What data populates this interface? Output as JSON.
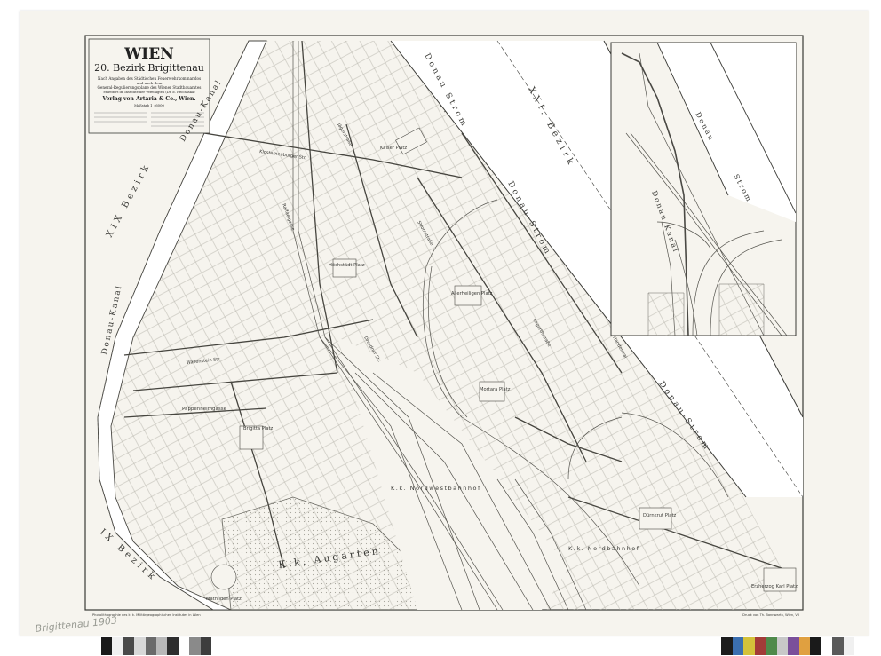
{
  "title_block": {
    "city": "WIEN",
    "district": "20. Bezirk Brigittenau",
    "subtitle_1": "Nach Angaben des Städtischen Feuerwehrkommandos",
    "subtitle_2": "und nach dem",
    "subtitle_3": "General-Regulierungsplane des Wiener Stadtbauamtes",
    "subtitle_4": "erweitert im Institute der Vereinigten (Dr. E. Prochaska)",
    "publisher": "Verlag von Artaria & Co., Wien.",
    "scale": "Maßstab 1 : 6000"
  },
  "regions": {
    "bezirk_xix": "XIX Bezirk",
    "bezirk_xxi": "XXI. Bezirk",
    "bezirk_ix": "IX Bezirk",
    "donau_kanal_top": "Donau-Kanal",
    "donau_kanal_left": "Donau-Kanal",
    "donau_strom_top": "Donau Strom",
    "donau_strom_mid": "Donau-Strom",
    "donau_strom_right": "Donau-Strom",
    "augarten": "K.k. Augarten",
    "nordwestbahnhof": "K.k. Nordwestbahnhof",
    "nordbahnhof": "K.k. Nordbahnhof"
  },
  "squares": {
    "kaiser_platz": "Kaiser Platz",
    "brigitta_platz": "Brigitta Platz",
    "mathilden_platz": "Mathilden Platz",
    "hoechstaedt_platz": "Höchstädt Platz",
    "allerheiligen_platz": "Allerheiligen Platz",
    "mortara_platz": "Mortara Platz",
    "durkrut_platz": "Dürnkrut Platz",
    "erzherzog_karl_platz": "Erzherzog Karl Platz"
  },
  "streets": {
    "pappenheim_gasse": "Pappenheimgasse",
    "klosterneuburger_strasse": "Klosterneuburger Str.",
    "wallenstein_strasse": "Wallenstein Str.",
    "raffael_gasse": "Raffaelgasse",
    "stromstrasse": "Stromstraße",
    "dresdner_strasse": "Dresdner Str.",
    "jaegerstrasse": "Jägerstraße",
    "engerthstrasse": "Engerthstraße",
    "handelskai": "Handelskai"
  },
  "inset": {
    "donau_label": "Donau",
    "strom_label": "Strom",
    "donau_kanal": "Donau Kanal"
  },
  "footer": {
    "left_credit": "Photolithographie des k. k. Militärgeographischen Institutes in Wien",
    "right_credit": "Druck von Th. Bannwarth, Wien, VII"
  },
  "annotation": {
    "pencil_note": "Brigittenau 1903"
  },
  "colors": {
    "paper": "#f6f4ee",
    "ink": "#3a3a36",
    "block_fill": "#ecebe3",
    "background": "#ffffff"
  },
  "color_strip_left": [
    "#1a1a1a",
    "#f0f0f0",
    "#4a4a4a",
    "#d8d8d8",
    "#6a6a6a",
    "#b8b8b8",
    "#2e2e2e",
    "#ffffff",
    "#8a8a8a",
    "#3d3d3d"
  ],
  "color_strip_right": [
    "#1c1c1c",
    "#3b6fb0",
    "#d4c23a",
    "#a33b38",
    "#4f8a4a",
    "#c8c8c8",
    "#7a4f9a",
    "#e0a040",
    "#1a1a1a",
    "#ffffff",
    "#5a5a5a",
    "#f0f0f0"
  ]
}
